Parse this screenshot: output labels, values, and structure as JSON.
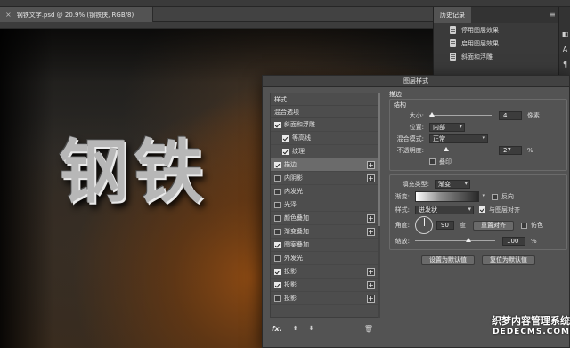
{
  "document": {
    "tab_title": "钢铁文字.psd @ 20.9% (钢铁侠, RGB/8)",
    "close_glyph": "×",
    "canvas_text": "钢铁"
  },
  "history_panel": {
    "tab_label": "历史记录",
    "items": [
      "停用图层效果",
      "启用图层效果",
      "斜面和浮雕"
    ]
  },
  "layer_style_dialog": {
    "title": "图层样式",
    "style_list": {
      "header_styles": "样式",
      "header_blend": "混合选项",
      "items": [
        {
          "label": "斜面和浮雕",
          "checked": true,
          "sub": false,
          "plus": false
        },
        {
          "label": "等高线",
          "checked": true,
          "sub": true,
          "plus": false
        },
        {
          "label": "纹理",
          "checked": true,
          "sub": true,
          "plus": false
        },
        {
          "label": "描边",
          "checked": true,
          "sub": false,
          "plus": true,
          "selected": true
        },
        {
          "label": "内阴影",
          "checked": false,
          "sub": false,
          "plus": true
        },
        {
          "label": "内发光",
          "checked": false,
          "sub": false,
          "plus": false
        },
        {
          "label": "光泽",
          "checked": false,
          "sub": false,
          "plus": false
        },
        {
          "label": "颜色叠加",
          "checked": false,
          "sub": false,
          "plus": true
        },
        {
          "label": "渐变叠加",
          "checked": false,
          "sub": false,
          "plus": true
        },
        {
          "label": "图案叠加",
          "checked": true,
          "sub": false,
          "plus": false
        },
        {
          "label": "外发光",
          "checked": false,
          "sub": false,
          "plus": false
        },
        {
          "label": "投影",
          "checked": true,
          "sub": false,
          "plus": true
        },
        {
          "label": "投影",
          "checked": true,
          "sub": false,
          "plus": true
        },
        {
          "label": "投影",
          "checked": false,
          "sub": false,
          "plus": true
        }
      ]
    },
    "footer": {
      "fx": "fx.",
      "up": "⬆",
      "down": "⬇",
      "trash": "🗑"
    },
    "stroke": {
      "section_title": "描边",
      "structure_title": "结构",
      "size_label": "大小:",
      "size_value": "4",
      "size_unit": "像素",
      "size_fraction": 0.04,
      "position_label": "位置:",
      "position_value": "内部",
      "blend_label": "混合模式:",
      "blend_value": "正常",
      "opacity_label": "不透明度:",
      "opacity_value": "27",
      "opacity_unit": "%",
      "opacity_fraction": 0.27,
      "overprint_label": "叠印",
      "fill_type_label": "填充类型:",
      "fill_type_value": "渐变",
      "gradient_label": "渐变:",
      "reverse_label": "反向",
      "style_label": "样式:",
      "style_value": "迸发状",
      "align_label": "与图层对齐",
      "angle_label": "角度:",
      "angle_value": "90",
      "angle_unit": "度",
      "reset_align_label": "重置对齐",
      "dither_label": "仿色",
      "scale_label": "缩放:",
      "scale_value": "100",
      "scale_unit": "%",
      "scale_fraction": 0.67,
      "set_default_label": "设置为默认值",
      "reset_default_label": "复位为默认值"
    }
  },
  "watermark": {
    "line1": "织梦内容管理系统",
    "line2": "DEDECMS.COM"
  }
}
